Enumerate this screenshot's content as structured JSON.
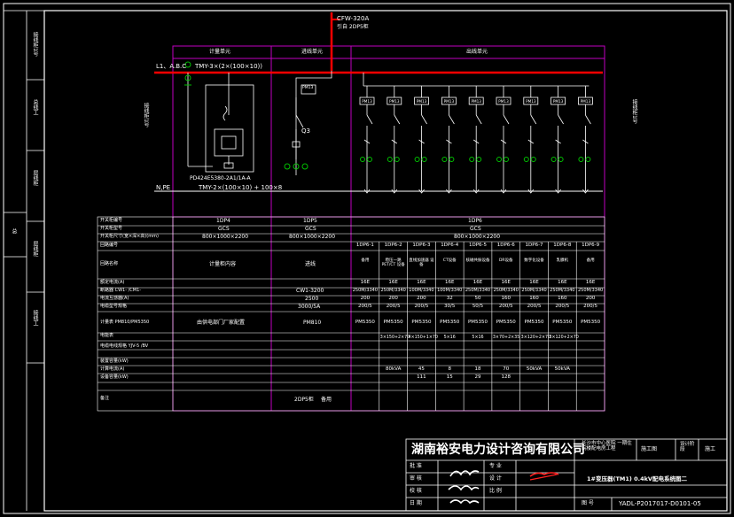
{
  "colors": {
    "background": "#000000",
    "frame": "#ffffff",
    "panel_border": "#c000c0",
    "busbar": "#ff0000",
    "device_green": "#00c000",
    "signature_red": "#ff2020"
  },
  "incoming": {
    "cable_label": "CFW-320A",
    "cable_sub": "引自 2DP5柜"
  },
  "left_labels": {
    "bus_abc": "L1、A.B.C",
    "bus_npe": "N,PE",
    "busbar_spec": "TMY-3×(2×(100×10))",
    "neutral_spec": "TMY-2×(100×10) + 100×8",
    "meter_model": "PD424E5380-2A1/1A-A"
  },
  "section_headers": [
    "计量单元",
    "进线单元",
    "出线单元"
  ],
  "q_label": "Q3",
  "outlet_breaker_label": "PM13",
  "margin_labels": [
    "接线柜1号",
    "接线柜1号",
    "接线柜1号"
  ],
  "left_strip": [
    "接线柜1号",
    "总线工",
    "层线柜",
    "层线柜",
    "接线工",
    "总"
  ],
  "table": {
    "row_labels": [
      "开关柜编号",
      "开关柜型号",
      "开关柜尺寸(宽×深×高)(mm)",
      "回路编号",
      "回路名称",
      "额定电流(A)",
      "断路器 CW1- /CM1-",
      "电流互感器(A)",
      "电缆型号规格",
      "计量表 PM810/PM5350",
      "电能表",
      "电缆电线规格 YJV-5 /BV",
      "",
      "装置容量(kW)",
      "计算电流(A)",
      "设备容量(kW)",
      "备注"
    ],
    "col1": {
      "cabinet": "1DP4",
      "type": "GCS",
      "size": "800×1000×2200",
      "name": "计量柜内容",
      "meter": "由供电部门厂家配置"
    },
    "col2": {
      "cabinet": "1DP5",
      "type": "GCS",
      "size": "800×1000×2200",
      "name": "进线",
      "breaker": "CW1-3200",
      "ct": "2500",
      "cable": "3000/5A",
      "meter": "PM810",
      "note1": "2DP5柜",
      "note2": "备用"
    },
    "col3": {
      "cabinet": "1DP6",
      "type": "GCS",
      "size": "800×1000×2200"
    },
    "circuits": [
      "1DP6-1",
      "1DP6-2",
      "1DP6-3",
      "1DP6-4",
      "1DP6-5",
      "1DP6-6",
      "1DP6-7",
      "1DP6-8",
      "1DP6-9"
    ],
    "circuit_names": [
      "备用",
      "稳压一路 PET/CT 设备",
      "直线加速器 设备",
      "CT设备",
      "核磁共振设备",
      "DR设备",
      "数字化设备",
      "乳腺机",
      "备用"
    ],
    "rated": [
      "16E",
      "16E",
      "16E",
      "16E",
      "16E",
      "16E",
      "16E",
      "16E",
      "16E"
    ],
    "breakers": [
      "250M/3340",
      "250M/3340",
      "100M/3340",
      "100M/3340",
      "250M/3340",
      "250M/3340",
      "250M/3340",
      "250M/3340",
      "250M/3340"
    ],
    "ct": [
      "200",
      "200",
      "200",
      "32",
      "50",
      "160",
      "160",
      "160",
      "200"
    ],
    "cable": [
      "200/5",
      "200/5",
      "200/5",
      "30/5",
      "50/5",
      "200/5",
      "200/5",
      "200/5",
      "200/5"
    ],
    "meters": [
      "PM5350",
      "PM5350",
      "PM5350",
      "PM5350",
      "PM5350",
      "PM5350",
      "PM5350",
      "PM5350",
      "PM5350"
    ],
    "cable_spec": [
      "",
      "3×150+2×70",
      "4×150+1×70",
      "5×16",
      "5×16",
      "3×70+2×35",
      "3×120+2×70",
      "3×120+2×70",
      ""
    ],
    "capacity": [
      "",
      "80kVA",
      "45",
      "8",
      "18",
      "70",
      "50kVA",
      "50kVA",
      ""
    ],
    "current": [
      "",
      "",
      "111",
      "15",
      "29",
      "128",
      "",
      "",
      ""
    ]
  },
  "title_block": {
    "company": "湖南裕安电力设计咨询有限公司",
    "project": "长沙市中心医院 一期住院楼配电房工程",
    "stage": "施工图",
    "design_label": "设计阶段",
    "design_value": "施工",
    "drawing_title": "1#变压器(TM1) 0.4kV配电系统图二",
    "drawing_no": "YADL-P2017017-D0101-05",
    "roles": [
      "批 准",
      "审 核",
      "校 核"
    ],
    "roles2": [
      "专 业",
      "设 计",
      "比 例"
    ],
    "date_label": "日 期",
    "no_label": "图 号"
  }
}
